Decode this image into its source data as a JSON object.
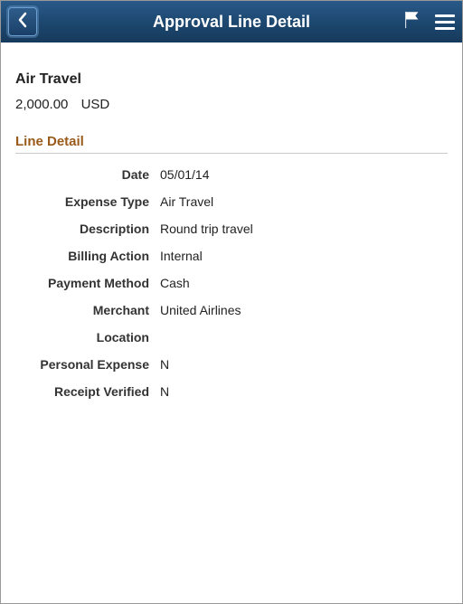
{
  "header": {
    "title": "Approval Line Detail"
  },
  "summary": {
    "type": "Air Travel",
    "amount": "2,000.00",
    "currency": "USD"
  },
  "section": {
    "title": "Line Detail"
  },
  "details": {
    "date_label": "Date",
    "date_value": "05/01/14",
    "expense_type_label": "Expense Type",
    "expense_type_value": "Air Travel",
    "description_label": "Description",
    "description_value": "Round trip travel",
    "billing_action_label": "Billing Action",
    "billing_action_value": "Internal",
    "payment_method_label": "Payment Method",
    "payment_method_value": "Cash",
    "merchant_label": "Merchant",
    "merchant_value": "United Airlines",
    "location_label": "Location",
    "location_value": "",
    "personal_expense_label": "Personal Expense",
    "personal_expense_value": "N",
    "receipt_verified_label": "Receipt Verified",
    "receipt_verified_value": "N"
  }
}
